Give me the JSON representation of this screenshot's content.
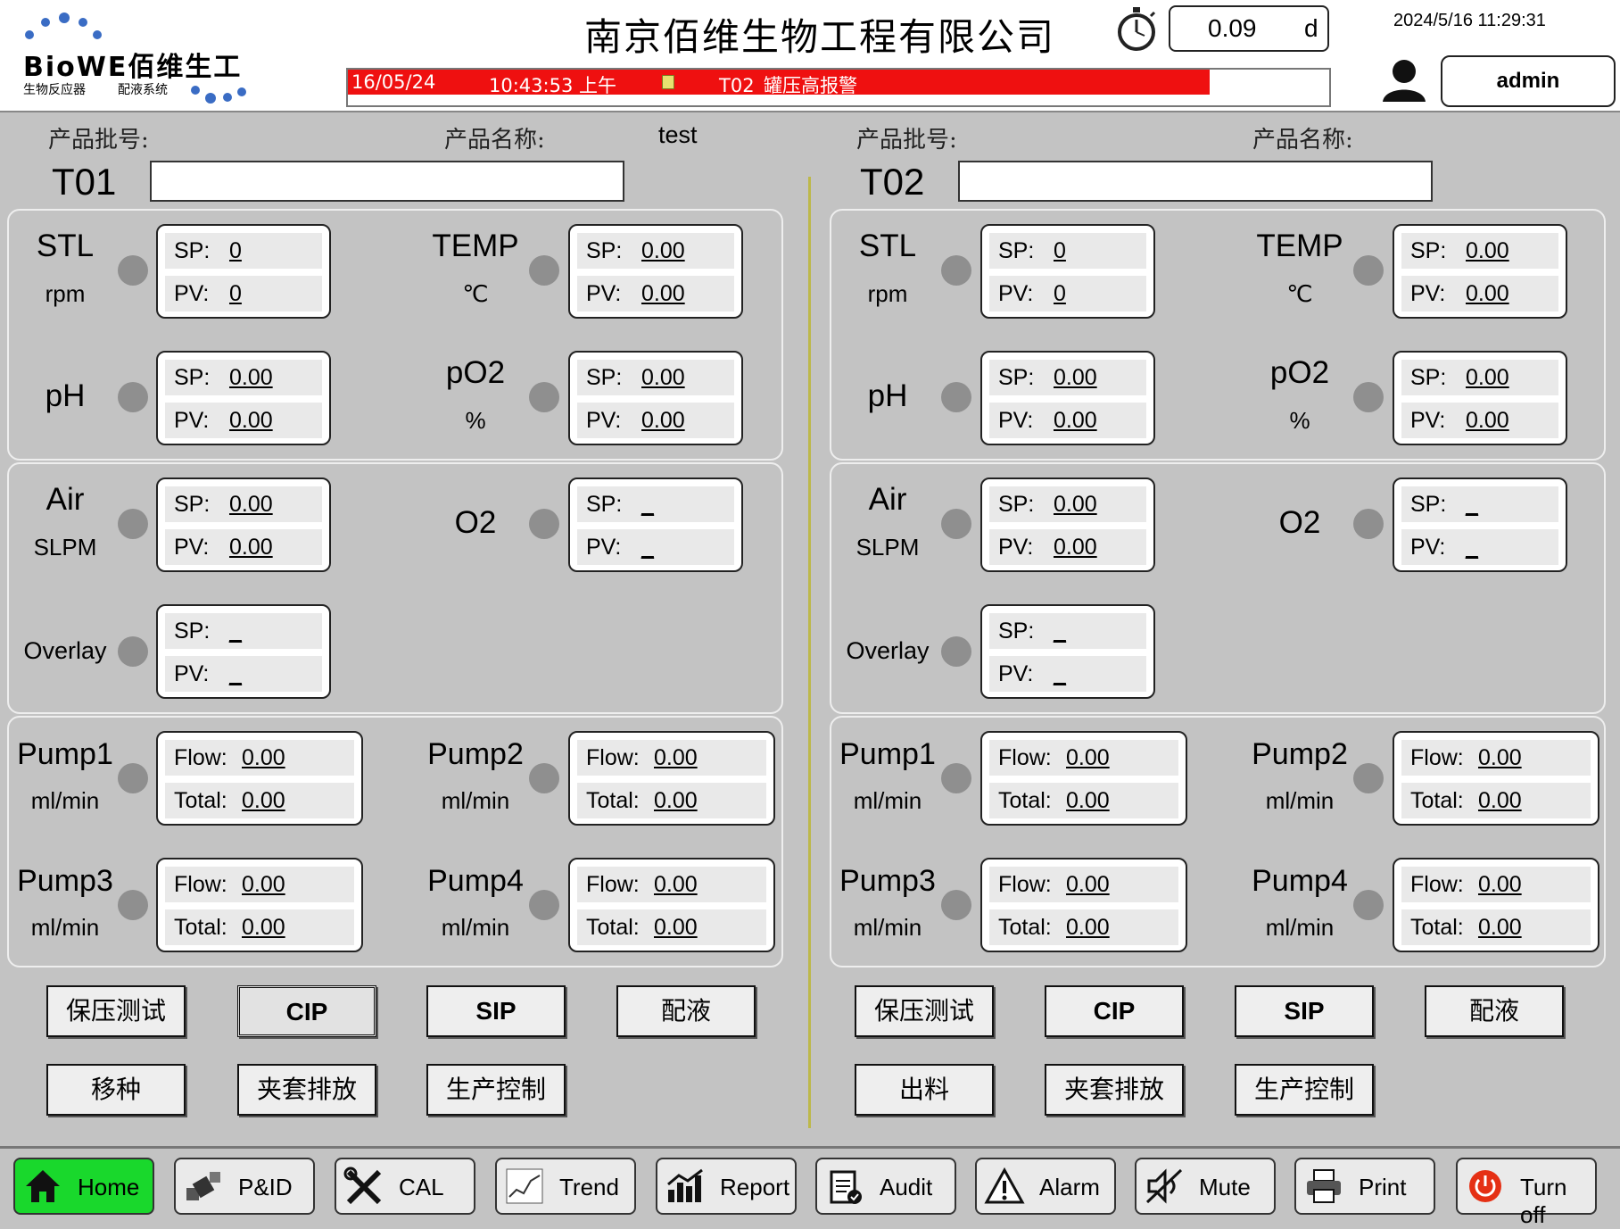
{
  "header": {
    "logo_text": "BioWE佰维生工",
    "logo_sub_left": "生物反应器",
    "logo_sub_right": "配液系统",
    "company_name": "南京佰维生物工程有限公司",
    "timer_value": "0.09",
    "timer_unit": "d",
    "datetime": "2024/5/16 11:29:31",
    "user": "admin",
    "alarm": {
      "date": "16/05/24",
      "time": "10:43:53 上午",
      "message": "T02_罐压高报警"
    }
  },
  "labels": {
    "batch_no": "产品批号:",
    "product_name": "产品名称:"
  },
  "tanks": [
    {
      "id": "T01",
      "product_name": "test",
      "batch_no": "",
      "stl": {
        "name": "STL",
        "unit": "rpm",
        "sp": "0",
        "pv": "0"
      },
      "temp": {
        "name": "TEMP",
        "unit": "℃",
        "sp": "0.00",
        "pv": "0.00"
      },
      "ph": {
        "name": "pH",
        "sp": "0.00",
        "pv": "0.00"
      },
      "po2": {
        "name": "pO2",
        "unit": "%",
        "sp": "0.00",
        "pv": "0.00"
      },
      "air": {
        "name": "Air",
        "unit": "SLPM",
        "sp": "0.00",
        "pv": "0.00"
      },
      "o2": {
        "name": "O2",
        "sp": "_",
        "pv": "_"
      },
      "overlay": {
        "name": "Overlay",
        "sp": "_",
        "pv": "_"
      },
      "pumps": [
        {
          "name": "Pump1",
          "unit": "ml/min",
          "flow": "0.00",
          "total": "0.00"
        },
        {
          "name": "Pump2",
          "unit": "ml/min",
          "flow": "0.00",
          "total": "0.00"
        },
        {
          "name": "Pump3",
          "unit": "ml/min",
          "flow": "0.00",
          "total": "0.00"
        },
        {
          "name": "Pump4",
          "unit": "ml/min",
          "flow": "0.00",
          "total": "0.00"
        }
      ],
      "actions": [
        "保压测试",
        "CIP",
        "SIP",
        "配液",
        "移种",
        "夹套排放",
        "生产控制"
      ]
    },
    {
      "id": "T02",
      "product_name": "",
      "batch_no": "",
      "stl": {
        "name": "STL",
        "unit": "rpm",
        "sp": "0",
        "pv": "0"
      },
      "temp": {
        "name": "TEMP",
        "unit": "℃",
        "sp": "0.00",
        "pv": "0.00"
      },
      "ph": {
        "name": "pH",
        "sp": "0.00",
        "pv": "0.00"
      },
      "po2": {
        "name": "pO2",
        "unit": "%",
        "sp": "0.00",
        "pv": "0.00"
      },
      "air": {
        "name": "Air",
        "unit": "SLPM",
        "sp": "0.00",
        "pv": "0.00"
      },
      "o2": {
        "name": "O2",
        "sp": "_",
        "pv": "_"
      },
      "overlay": {
        "name": "Overlay",
        "sp": "_",
        "pv": "_"
      },
      "pumps": [
        {
          "name": "Pump1",
          "unit": "ml/min",
          "flow": "0.00",
          "total": "0.00"
        },
        {
          "name": "Pump2",
          "unit": "ml/min",
          "flow": "0.00",
          "total": "0.00"
        },
        {
          "name": "Pump3",
          "unit": "ml/min",
          "flow": "0.00",
          "total": "0.00"
        },
        {
          "name": "Pump4",
          "unit": "ml/min",
          "flow": "0.00",
          "total": "0.00"
        }
      ],
      "actions": [
        "保压测试",
        "CIP",
        "SIP",
        "配液",
        "出料",
        "夹套排放",
        "生产控制"
      ]
    }
  ],
  "value_labels": {
    "sp": "SP:",
    "pv": "PV:",
    "flow": "Flow:",
    "total": "Total:"
  },
  "nav": [
    {
      "label": "Home",
      "icon": "home-icon"
    },
    {
      "label": "P&ID",
      "icon": "valve-icon"
    },
    {
      "label": "CAL",
      "icon": "tools-icon"
    },
    {
      "label": "Trend",
      "icon": "trend-chart-icon"
    },
    {
      "label": "Report",
      "icon": "report-chart-icon"
    },
    {
      "label": "Audit",
      "icon": "clipboard-icon"
    },
    {
      "label": "Alarm",
      "icon": "warning-icon"
    },
    {
      "label": "Mute",
      "icon": "mute-icon"
    },
    {
      "label": "Print",
      "icon": "printer-icon"
    },
    {
      "label": "Turn off",
      "icon": "power-icon"
    }
  ],
  "colors": {
    "alarm": "#ef1010",
    "home_active": "#19d82c",
    "background": "#c3c3c3"
  }
}
